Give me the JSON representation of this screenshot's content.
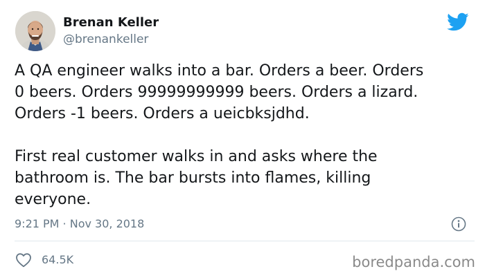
{
  "author": {
    "display_name": "Brenan Keller",
    "handle": "@brenankeller",
    "avatar_icon": "profile-photo"
  },
  "brand": {
    "logo_icon": "twitter-bird-icon",
    "accent_color": "#1da1f2"
  },
  "tweet": {
    "paragraphs": [
      "A QA engineer walks into a bar. Orders a beer. Orders\n0 beers. Orders 99999999999 beers. Orders a lizard.\nOrders -1 beers. Orders a ueicbksjdhd.",
      "First real customer walks in and asks where the\nbathroom is. The bar bursts into flames, killing\neveryone."
    ],
    "timestamp": "9:21 PM · Nov 30, 2018",
    "info_icon": "info-icon"
  },
  "engagement": {
    "like_icon": "heart-icon",
    "like_count": "64.5K"
  },
  "watermark": "boredpanda.com"
}
